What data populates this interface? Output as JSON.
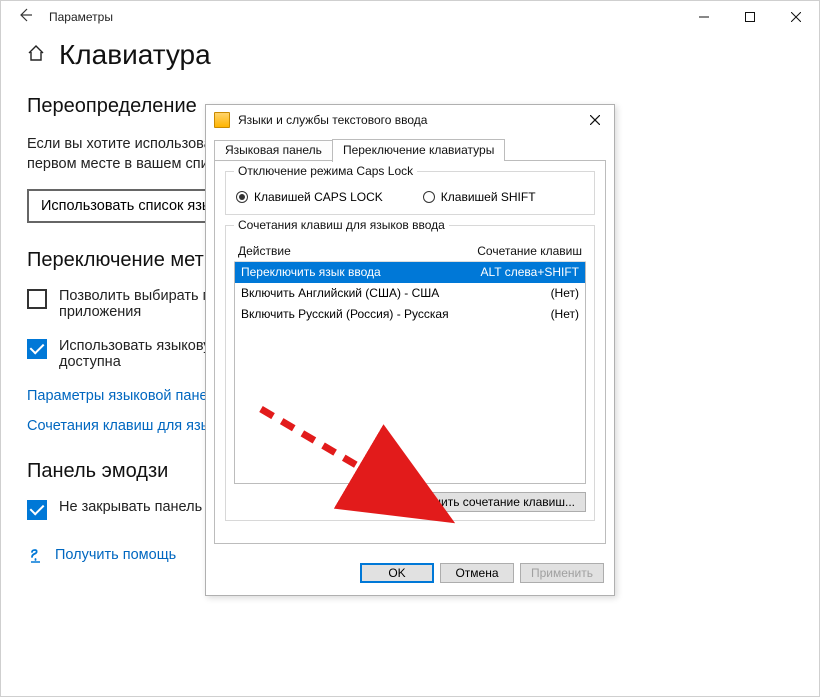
{
  "window": {
    "title": "Параметры",
    "page_title": "Клавиатура"
  },
  "sections": {
    "override": {
      "title": "Переопределение",
      "desc": "Если вы хотите использова\nпервом месте в вашем спи",
      "dropdown": "Использовать список язы"
    },
    "switch": {
      "title": "Переключение мет",
      "cb1": "Позволить выбирать м\nприложения",
      "cb2": "Использовать языкову\nдоступна",
      "link1": "Параметры языковой пане",
      "link2": "Сочетания клавиш для язы"
    },
    "emoji": {
      "title": "Панель эмодзи",
      "cb": "Не закрывать панель автоматически после ввода эмодзи"
    },
    "help": {
      "link": "Получить помощь"
    }
  },
  "dialog": {
    "title": "Языки и службы текстового ввода",
    "tabs": {
      "panel": "Языковая панель",
      "switch": "Переключение клавиатуры"
    },
    "caps_group": {
      "legend": "Отключение режима Caps Lock",
      "opt1": "Клавишей CAPS LOCK",
      "opt2": "Клавишей SHIFT"
    },
    "hotkey_group": {
      "legend": "Сочетания клавиш для языков ввода",
      "col_action": "Действие",
      "col_combo": "Сочетание клавиш",
      "rows": [
        {
          "action": "Переключить язык ввода",
          "combo": "ALT слева+SHIFT"
        },
        {
          "action": "Включить Английский (США) - США",
          "combo": "(Нет)"
        },
        {
          "action": "Включить Русский (Россия) - Русская",
          "combo": "(Нет)"
        }
      ],
      "change_btn": "Сменить сочетание клавиш..."
    },
    "buttons": {
      "ok": "OK",
      "cancel": "Отмена",
      "apply": "Применить"
    }
  }
}
